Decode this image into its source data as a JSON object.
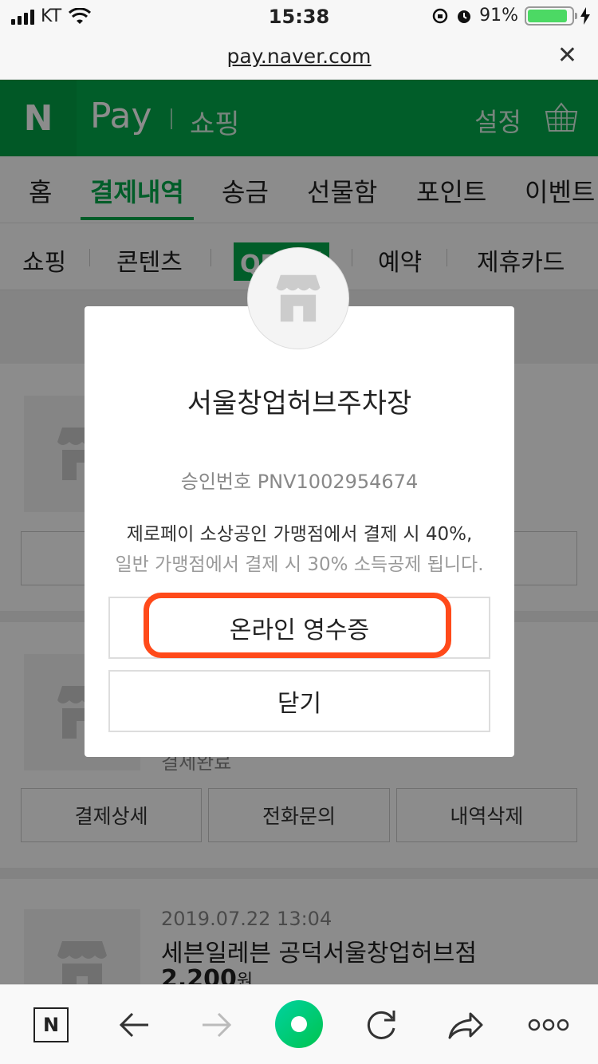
{
  "status_bar": {
    "carrier": "KT",
    "time": "15:38",
    "battery_percent": "91%",
    "battery_level": 0.91
  },
  "url_bar": {
    "url": "pay.naver.com",
    "close_icon": "close-icon"
  },
  "header": {
    "logo": "N",
    "brand": "Pay",
    "section": "쇼핑",
    "settings": "설정",
    "cart_icon": "basket-icon"
  },
  "tabs": [
    {
      "label": "홈",
      "active": false
    },
    {
      "label": "결제내역",
      "active": true
    },
    {
      "label": "송금",
      "active": false
    },
    {
      "label": "선물함",
      "active": false
    },
    {
      "label": "포인트",
      "active": false
    },
    {
      "label": "이벤트",
      "active": false
    }
  ],
  "subtabs": [
    {
      "label": "쇼핑"
    },
    {
      "label": "콘텐츠"
    },
    {
      "label": "QR결제"
    },
    {
      "label": "예약"
    },
    {
      "label": "제휴카드"
    }
  ],
  "list": {
    "card2": {
      "status": "결제완료",
      "buttons": [
        "결제상세",
        "전화문의",
        "내역삭제"
      ]
    },
    "card3": {
      "date": "2019.07.22 13:04",
      "title": "세븐일레븐 공덕서울창업허브점",
      "price": "2,200",
      "currency": "원"
    }
  },
  "modal": {
    "store_name": "서울창업허브주차장",
    "approval": "승인번호 PNV1002954674",
    "notice_line1": "제로페이 소상공인 가맹점에서 결제 시 40%,",
    "notice_line2": "일반 가맹점에서 결제 시 30% 소득공제 됩니다.",
    "receipt_button": "온라인 영수증",
    "close_button": "닫기"
  },
  "colors": {
    "brand_green": "#03a94b",
    "highlight": "#ff4a1a"
  },
  "toolbar": {
    "naver_label": "N"
  }
}
